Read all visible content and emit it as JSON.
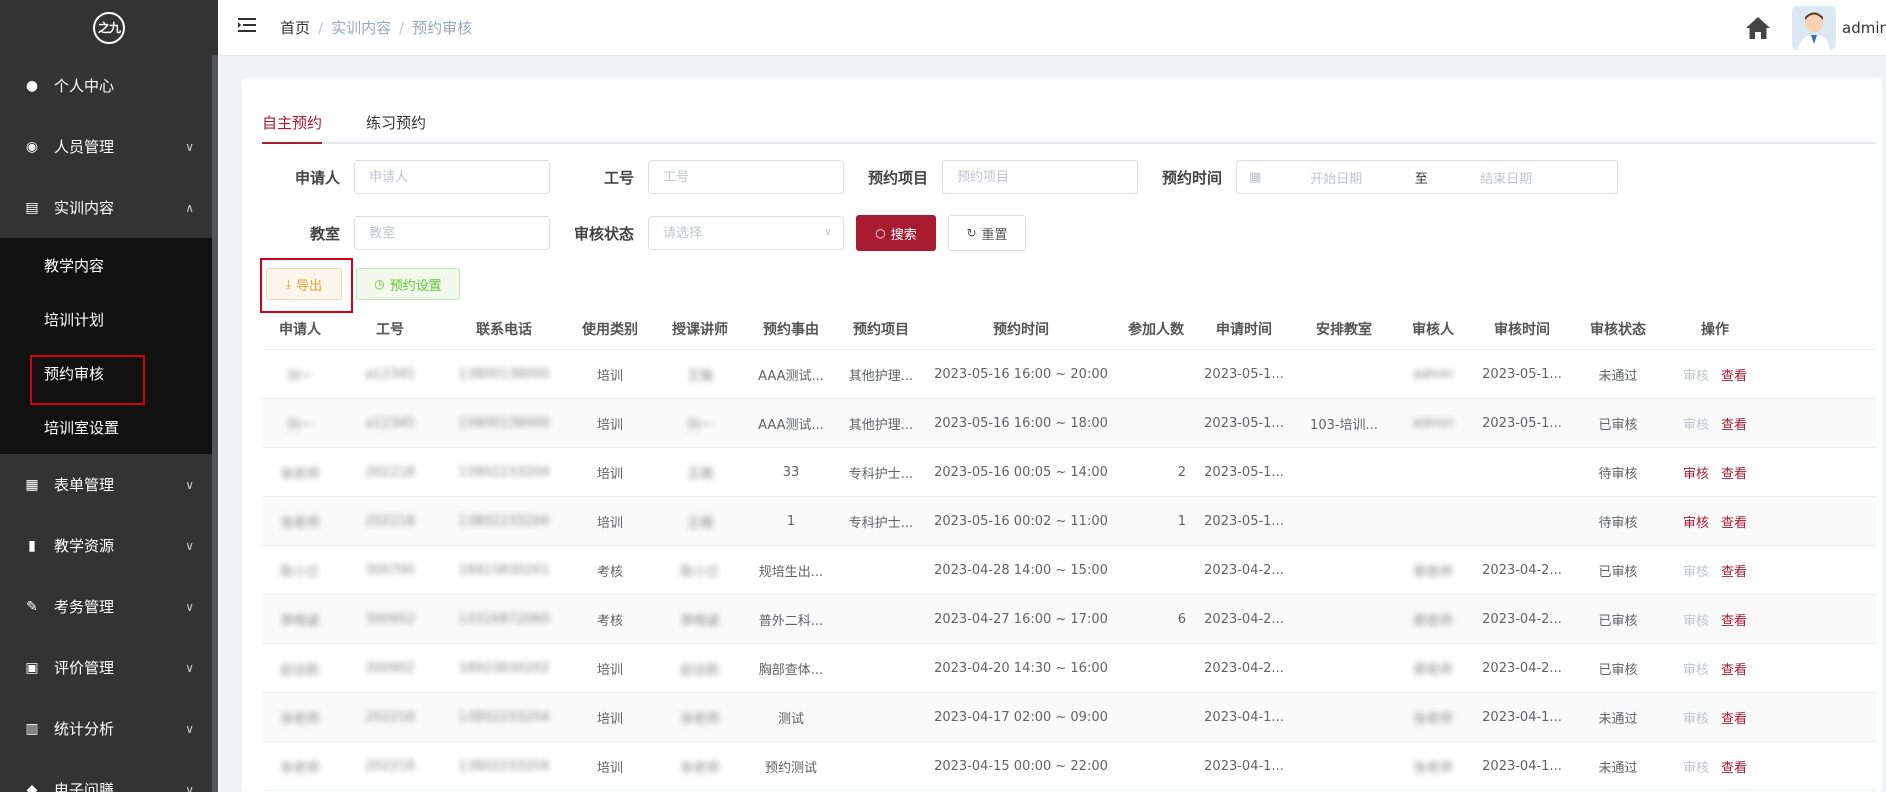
{
  "sidebar": {
    "logo_text": "之九",
    "items": [
      {
        "label": "个人中心",
        "icon": "user-icon",
        "has_children": false
      },
      {
        "label": "人员管理",
        "icon": "users-icon",
        "has_children": true
      },
      {
        "label": "实训内容",
        "icon": "book-icon",
        "has_children": true,
        "expanded": true
      },
      {
        "label": "表单管理",
        "icon": "form-icon",
        "has_children": true
      },
      {
        "label": "教学资源",
        "icon": "resource-icon",
        "has_children": true
      },
      {
        "label": "考务管理",
        "icon": "edit-icon",
        "has_children": true
      },
      {
        "label": "评价管理",
        "icon": "rating-icon",
        "has_children": true
      },
      {
        "label": "统计分析",
        "icon": "chart-icon",
        "has_children": true
      },
      {
        "label": "电子问膳",
        "icon": "misc-icon",
        "has_children": true
      }
    ],
    "submenu": [
      {
        "label": "教学内容"
      },
      {
        "label": "培训计划"
      },
      {
        "label": "预约审核",
        "active": true
      },
      {
        "label": "培训室设置"
      }
    ]
  },
  "header": {
    "breadcrumb": [
      "首页",
      "实训内容",
      "预约审核"
    ],
    "username": "admin"
  },
  "tabs": [
    {
      "label": "自主预约",
      "active": true
    },
    {
      "label": "练习预约",
      "active": false
    }
  ],
  "filters": {
    "applicant_label": "申请人",
    "applicant_placeholder": "申请人",
    "workno_label": "工号",
    "workno_placeholder": "工号",
    "project_label": "预约项目",
    "project_placeholder": "预约项目",
    "time_label": "预约时间",
    "start_placeholder": "开始日期",
    "to": "至",
    "end_placeholder": "结束日期",
    "room_label": "教室",
    "room_placeholder": "教室",
    "status_label": "审核状态",
    "status_placeholder": "请选择",
    "search_label": "搜索",
    "reset_label": "重置"
  },
  "actions": {
    "export_label": "导出",
    "settings_label": "预约设置"
  },
  "table": {
    "columns": [
      "申请人",
      "工号",
      "联系电话",
      "使用类别",
      "授课讲师",
      "预约事由",
      "预约项目",
      "预约时间",
      "参加人数",
      "申请时间",
      "安排教室",
      "审核人",
      "审核时间",
      "审核状态",
      "操作"
    ],
    "audit_label": "审核",
    "view_label": "查看",
    "rows": [
      {
        "applicant": "刘一",
        "workno": "a12345",
        "phone": "13800138000",
        "category": "培训",
        "teacher": "王璐",
        "reason": "AAA测试...",
        "project": "其他护理...",
        "time": "2023-05-16 16:00 ~ 20:00",
        "count": "",
        "apply_time": "2023-05-1...",
        "room": "",
        "auditor": "admin",
        "audit_time": "2023-05-1...",
        "status": "未通过",
        "audit_enabled": false
      },
      {
        "applicant": "刘一",
        "workno": "a12345",
        "phone": "13800138000",
        "category": "培训",
        "teacher": "刘一",
        "reason": "AAA测试...",
        "project": "其他护理...",
        "time": "2023-05-16 16:00 ~ 18:00",
        "count": "",
        "apply_time": "2023-05-1...",
        "room": "103-培训...",
        "auditor": "admin",
        "audit_time": "2023-05-1...",
        "status": "已审核",
        "audit_enabled": false
      },
      {
        "applicant": "张老师",
        "workno": "202218",
        "phone": "13802233204",
        "category": "培训",
        "teacher": "王璐",
        "reason": "33",
        "project": "专科护士...",
        "time": "2023-05-16 00:05 ~ 14:00",
        "count": "2",
        "apply_time": "2023-05-1...",
        "room": "",
        "auditor": "",
        "audit_time": "",
        "status": "待审核",
        "audit_enabled": true
      },
      {
        "applicant": "张老师",
        "workno": "202218",
        "phone": "13802233204",
        "category": "培训",
        "teacher": "王璐",
        "reason": "1",
        "project": "专科护士...",
        "time": "2023-05-16 00:02 ~ 11:00",
        "count": "1",
        "apply_time": "2023-05-1...",
        "room": "",
        "auditor": "",
        "audit_time": "",
        "status": "待审核",
        "audit_enabled": true
      },
      {
        "applicant": "陈小兰",
        "workno": "300790",
        "phone": "18923830201",
        "category": "考核",
        "teacher": "陈小兰",
        "reason": "规培生出...",
        "project": "",
        "time": "2023-04-28 14:00 ~ 15:00",
        "count": "",
        "apply_time": "2023-04-2...",
        "room": "",
        "auditor": "郭老师",
        "audit_time": "2023-04-2...",
        "status": "已审核",
        "audit_enabled": false
      },
      {
        "applicant": "李晓波",
        "workno": "300952",
        "phone": "13316872060",
        "category": "考核",
        "teacher": "李晓波",
        "reason": "普外二科...",
        "project": "",
        "time": "2023-04-27 16:00 ~ 17:00",
        "count": "6",
        "apply_time": "2023-04-2...",
        "room": "",
        "auditor": "郭老师",
        "audit_time": "2023-04-2...",
        "status": "已审核",
        "audit_enabled": false
      },
      {
        "applicant": "赵远航",
        "workno": "300902",
        "phone": "18923830202",
        "category": "培训",
        "teacher": "赵远航",
        "reason": "胸部查体...",
        "project": "",
        "time": "2023-04-20 14:30 ~ 16:00",
        "count": "",
        "apply_time": "2023-04-2...",
        "room": "",
        "auditor": "郭老师",
        "audit_time": "2023-04-2...",
        "status": "已审核",
        "audit_enabled": false
      },
      {
        "applicant": "张老师",
        "workno": "202218",
        "phone": "13802233204",
        "category": "培训",
        "teacher": "张老师",
        "reason": "测试",
        "project": "",
        "time": "2023-04-17 02:00 ~ 09:00",
        "count": "",
        "apply_time": "2023-04-1...",
        "room": "",
        "auditor": "张老师",
        "audit_time": "2023-04-1...",
        "status": "未通过",
        "audit_enabled": false
      },
      {
        "applicant": "张老师",
        "workno": "202218",
        "phone": "13802233204",
        "category": "培训",
        "teacher": "张老师",
        "reason": "预约测试",
        "project": "",
        "time": "2023-04-15 00:00 ~ 22:00",
        "count": "",
        "apply_time": "2023-04-1...",
        "room": "",
        "auditor": "张老师",
        "audit_time": "2023-04-1...",
        "status": "未通过",
        "audit_enabled": false
      }
    ]
  }
}
